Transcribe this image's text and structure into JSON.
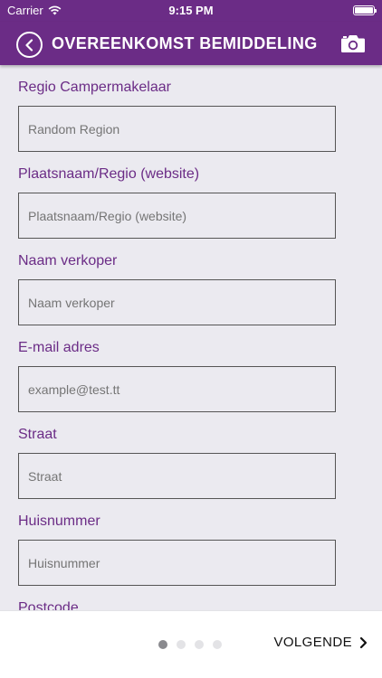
{
  "status_bar": {
    "carrier": "Carrier",
    "time": "9:15 PM"
  },
  "header": {
    "title": "OVEREENKOMST BEMIDDELING"
  },
  "form": {
    "fields": [
      {
        "label": "Regio Campermakelaar",
        "placeholder": "Random Region"
      },
      {
        "label": "Plaatsnaam/Regio (website)",
        "placeholder": "Plaatsnaam/Regio (website)"
      },
      {
        "label": "Naam verkoper",
        "placeholder": "Naam verkoper"
      },
      {
        "label": "E-mail adres",
        "placeholder": "example@test.tt"
      },
      {
        "label": "Straat",
        "placeholder": "Straat"
      },
      {
        "label": "Huisnummer",
        "placeholder": "Huisnummer"
      },
      {
        "label": "Postcode"
      }
    ]
  },
  "footer": {
    "pager": {
      "current": 1,
      "total": 4
    },
    "next_label": "VOLGENDE"
  },
  "colors": {
    "accent": "#6b2c86",
    "background": "#ebeaf0"
  }
}
